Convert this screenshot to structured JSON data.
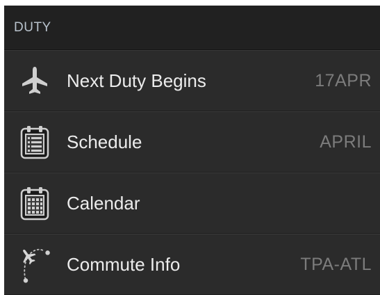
{
  "section": {
    "title": "DUTY"
  },
  "rows": [
    {
      "icon": "airplane-icon",
      "label": "Next Duty Begins",
      "value": "17APR"
    },
    {
      "icon": "schedule-clipboard-icon",
      "label": "Schedule",
      "value": "APRIL"
    },
    {
      "icon": "calendar-icon",
      "label": "Calendar",
      "value": ""
    },
    {
      "icon": "commute-route-icon",
      "label": "Commute Info",
      "value": "TPA-ATL"
    }
  ],
  "colors": {
    "background": "#2b2b2b",
    "header_background": "#212121",
    "header_text": "#b8c2cc",
    "label_text": "#ececec",
    "value_text": "#7c7c7c",
    "icon": "#d0d0d0"
  }
}
